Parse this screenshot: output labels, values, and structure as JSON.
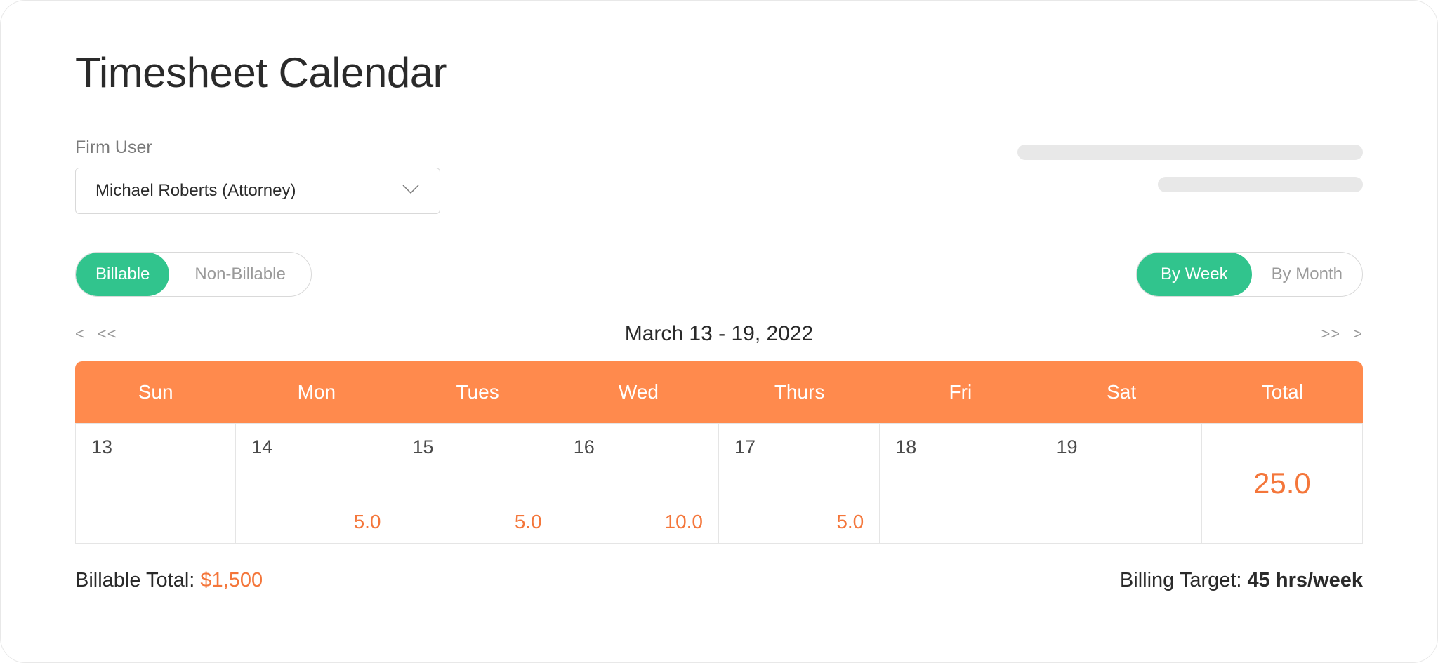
{
  "title": "Timesheet Calendar",
  "userField": {
    "label": "Firm User",
    "value": "Michael Roberts (Attorney)"
  },
  "filters": {
    "billable": "Billable",
    "nonBillable": "Non-Billable"
  },
  "view": {
    "byWeek": "By Week",
    "byMonth": "By Month"
  },
  "dateNav": {
    "first": "<",
    "prev": "<<",
    "range": "March 13 - 19, 2022",
    "next": ">>",
    "last": ">"
  },
  "calendar": {
    "headers": [
      "Sun",
      "Mon",
      "Tues",
      "Wed",
      "Thurs",
      "Fri",
      "Sat",
      "Total"
    ],
    "days": [
      {
        "date": "13",
        "hours": ""
      },
      {
        "date": "14",
        "hours": "5.0"
      },
      {
        "date": "15",
        "hours": "5.0"
      },
      {
        "date": "16",
        "hours": "10.0"
      },
      {
        "date": "17",
        "hours": "5.0"
      },
      {
        "date": "18",
        "hours": ""
      },
      {
        "date": "19",
        "hours": ""
      }
    ],
    "totalHours": "25.0"
  },
  "footer": {
    "billableLabel": "Billable Total: ",
    "billableAmount": "$1,500",
    "targetLabel": "Billing Target: ",
    "targetValue": "45 hrs/week"
  }
}
